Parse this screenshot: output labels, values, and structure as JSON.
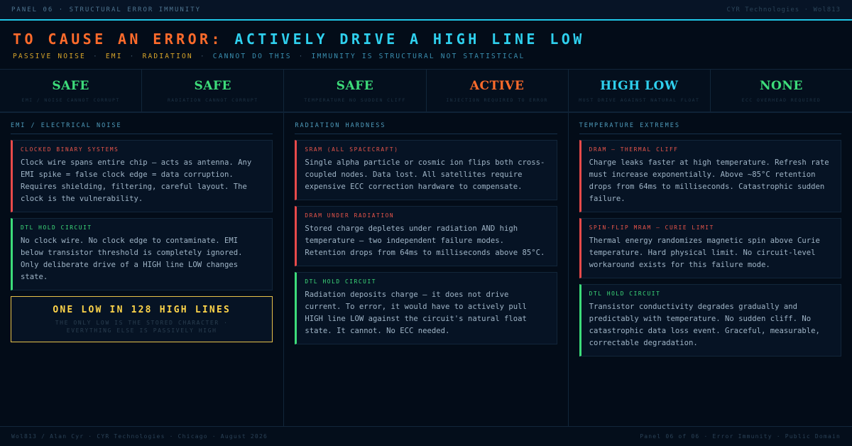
{
  "topbar": {
    "left": "PANEL 06 · STRUCTURAL ERROR IMMUNITY",
    "right": "CYR Technologies · Wol813"
  },
  "header": {
    "headline_part1": "TO CAUSE AN ERROR:",
    "headline_part2": "ACTIVELY DRIVE A HIGH LINE LOW",
    "sub_items": [
      {
        "text": "PASSIVE NOISE",
        "tone": "bad"
      },
      {
        "text": "EMI",
        "tone": "bad"
      },
      {
        "text": "RADIATION",
        "tone": "bad"
      },
      {
        "text": "CANNOT DO THIS",
        "tone": "good"
      },
      {
        "text": "IMMUNITY IS STRUCTURAL NOT STATISTICAL",
        "tone": "good"
      }
    ],
    "separator": "·"
  },
  "stats": [
    {
      "value": "SAFE",
      "label": "EMI / NOISE CANNOT CORRUPT",
      "color": "#3ddc7a"
    },
    {
      "value": "SAFE",
      "label": "RADIATION CANNOT CORRUPT",
      "color": "#3ddc7a"
    },
    {
      "value": "SAFE",
      "label": "TEMPERATURE NO SUDDEN CLIFF",
      "color": "#3ddc7a"
    },
    {
      "value": "ACTIVE",
      "label": "INJECTION REQUIRED TO ERROR",
      "color": "#ff6b2b"
    },
    {
      "value": "HIGH LOW",
      "label": "MUST DRIVE AGAINST NATURAL FLOAT",
      "color": "#2fd0ee"
    },
    {
      "value": "NONE",
      "label": "ECC OVERHEAD REQUIRED",
      "color": "#3ddc7a"
    }
  ],
  "columns": [
    {
      "title": "EMI / ELECTRICAL NOISE",
      "cards": [
        {
          "status": "bad",
          "title": "CLOCKED BINARY SYSTEMS",
          "body": "Clock wire spans entire chip — acts as antenna. Any EMI spike = false clock edge = data corruption. Requires shielding, filtering, careful layout. The clock is the vulnerability."
        },
        {
          "status": "ok",
          "title": "DTL HOLD CIRCUIT",
          "body": "No clock wire. No clock edge to contaminate. EMI below transistor threshold is completely ignored. Only deliberate drive of a HIGH line LOW changes state."
        }
      ],
      "callout": {
        "title": "ONE LOW IN 128 HIGH LINES",
        "line1": "THE ONLY LOW IS THE STORED CHARACTER ·",
        "line2": "EVERYTHING ELSE IS PASSIVELY HIGH"
      }
    },
    {
      "title": "RADIATION HARDNESS",
      "cards": [
        {
          "status": "bad",
          "title": "SRAM (ALL SPACECRAFT)",
          "body": "Single alpha particle or cosmic ion flips both cross-coupled nodes. Data lost. All satellites require expensive ECC correction hardware to compensate."
        },
        {
          "status": "bad",
          "title": "DRAM UNDER RADIATION",
          "body": "Stored charge depletes under radiation AND high temperature — two independent failure modes. Retention drops from 64ms to milliseconds above 85°C."
        },
        {
          "status": "ok",
          "title": "DTL HOLD CIRCUIT",
          "body": "Radiation deposits charge — it does not drive current. To error, it would have to actively pull HIGH line LOW against the circuit's natural float state. It cannot. No ECC needed."
        }
      ]
    },
    {
      "title": "TEMPERATURE EXTREMES",
      "cards": [
        {
          "status": "bad",
          "title": "DRAM — THERMAL CLIFF",
          "body": "Charge leaks faster at high temperature. Refresh rate must increase exponentially. Above ~85°C retention drops from 64ms to milliseconds. Catastrophic sudden failure."
        },
        {
          "status": "bad",
          "title": "SPIN-FLIP MRAM — CURIE LIMIT",
          "body": "Thermal energy randomizes magnetic spin above Curie temperature. Hard physical limit. No circuit-level workaround exists for this failure mode."
        },
        {
          "status": "ok",
          "title": "DTL HOLD CIRCUIT",
          "body": "Transistor conductivity degrades gradually and predictably with temperature. No sudden cliff. No catastrophic data loss event. Graceful, measurable, correctable degradation."
        }
      ]
    }
  ],
  "footer": {
    "left": "Wol813 / Alan Cyr · CYR Technologies · Chicago · August 2026",
    "right": "Panel 06 of 06 · Error Immunity · Public Domain"
  }
}
